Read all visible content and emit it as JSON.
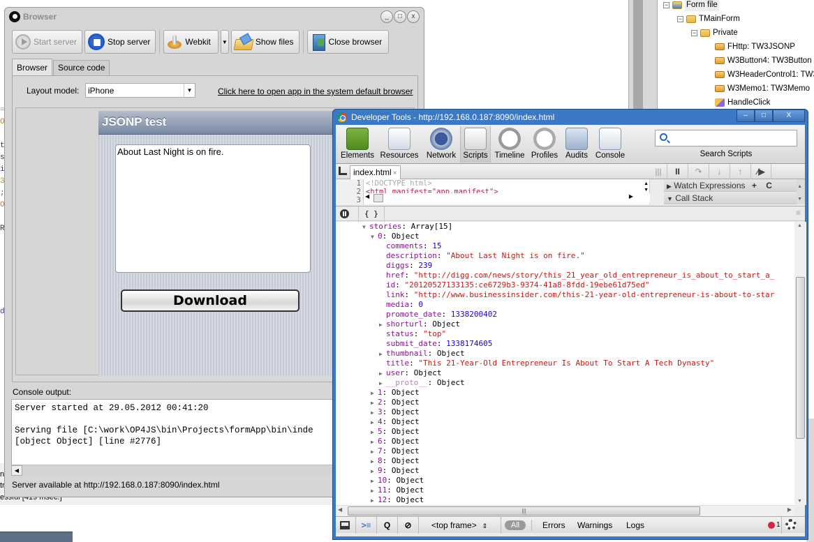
{
  "background": {
    "left_code_glyphs": [
      "=",
      "O",
      "",
      "t",
      "s",
      "i",
      "3",
      ";",
      "O",
      "",
      "R",
      "",
      "",
      "",
      "",
      "",
      "",
      "d"
    ],
    "left_status_lines": [
      "n",
      "tri",
      "essful [419 msec.]"
    ],
    "tree": {
      "items": [
        {
          "label": "Form file",
          "icon": "form-file-icon"
        },
        {
          "label": "TMainForm",
          "icon": "folder-icon"
        },
        {
          "label": "Private",
          "icon": "folder-icon"
        },
        {
          "label": "FHttp: TW3JSONP",
          "icon": "field-icon"
        },
        {
          "label": "W3Button4: TW3Button",
          "icon": "field-icon"
        },
        {
          "label": "W3HeaderControl1: TW3",
          "icon": "field-icon"
        },
        {
          "label": "W3Memo1: TW3Memo",
          "icon": "field-icon"
        },
        {
          "label": "HandleClick",
          "icon": "method-icon"
        }
      ]
    }
  },
  "browser": {
    "title": "Browser",
    "window_controls": [
      "_",
      "□",
      "x"
    ],
    "toolbar": {
      "start_server": "Start server",
      "stop_server": "Stop server",
      "webkit": "Webkit",
      "show_files": "Show files",
      "close_browser": "Close browser"
    },
    "tabs": [
      {
        "label": "Browser",
        "active": true
      },
      {
        "label": "Source code",
        "active": false
      }
    ],
    "layout_label": "Layout model:",
    "layout_value": "iPhone",
    "open_link": "Click here to open app in the system default browser",
    "app": {
      "header": "JSONP test",
      "memo_text": "About Last Night is on fire.",
      "download_button": "Download"
    },
    "console_label": "Console output:",
    "console_lines": [
      "Server started at 29.05.2012 00:41:20",
      "",
      "Serving file [C:\\work\\OP4JS\\bin\\Projects\\formApp\\bin\\inde",
      "[object Object] [line #2776]"
    ],
    "status": "Server available at http://192.168.0.187:8090/index.html"
  },
  "devtools": {
    "title": "Developer Tools - http://192.168.0.187:8090/index.html",
    "window_controls": [
      "–",
      "□",
      "X"
    ],
    "panels": [
      {
        "label": "Elements",
        "icon": "elements-icon"
      },
      {
        "label": "Resources",
        "icon": "resources-icon"
      },
      {
        "label": "Network",
        "icon": "network-icon"
      },
      {
        "label": "Scripts",
        "icon": "scripts-icon",
        "active": true
      },
      {
        "label": "Timeline",
        "icon": "timeline-icon"
      },
      {
        "label": "Profiles",
        "icon": "profiles-icon"
      },
      {
        "label": "Audits",
        "icon": "audits-icon"
      },
      {
        "label": "Console",
        "icon": "console-icon"
      }
    ],
    "search_label": "Search Scripts",
    "search_value": "",
    "file_tab": "index.html",
    "file_tab_close": "×",
    "debugger_buttons": [
      "pause",
      "step-over",
      "step-into",
      "step-out",
      "deactivate-breakpoints"
    ],
    "code_lines": [
      {
        "num": "1",
        "text": "<!DOCTYPE html>"
      },
      {
        "num": "2",
        "text": "<html manifest=\"app.manifest\">"
      },
      {
        "num": "3",
        "text": ""
      }
    ],
    "watch_expressions": "Watch Expressions",
    "call_stack": "Call Stack",
    "pretty_print": "{ }",
    "console_tree": {
      "root": {
        "key": "stories",
        "value": "Array[15]"
      },
      "item0": {
        "key": "0",
        "value": "Object"
      },
      "props": [
        {
          "key": "comments",
          "value": "15",
          "type": "number"
        },
        {
          "key": "description",
          "value": "\"About Last Night is on fire.\"",
          "type": "string"
        },
        {
          "key": "diggs",
          "value": "239",
          "type": "number"
        },
        {
          "key": "href",
          "value": "\"http://digg.com/news/story/this_21_year_old_entrepreneur_is_about_to_start_a_",
          "type": "string"
        },
        {
          "key": "id",
          "value": "\"20120527133135:ce6729b3-9374-41a8-8fdd-19ebe61d75ed\"",
          "type": "string"
        },
        {
          "key": "link",
          "value": "\"http://www.businessinsider.com/this-21-year-old-entrepreneur-is-about-to-star",
          "type": "string"
        },
        {
          "key": "media",
          "value": "0",
          "type": "number"
        },
        {
          "key": "promote_date",
          "value": "1338200402",
          "type": "number"
        },
        {
          "key": "shorturl",
          "value": "Object",
          "type": "object"
        },
        {
          "key": "status",
          "value": "\"top\"",
          "type": "string"
        },
        {
          "key": "submit_date",
          "value": "1338174605",
          "type": "number"
        },
        {
          "key": "thumbnail",
          "value": "Object",
          "type": "object"
        },
        {
          "key": "title",
          "value": "\"This 21-Year-Old Entrepreneur Is About To Start A Tech Dynasty\"",
          "type": "string"
        },
        {
          "key": "user",
          "value": "Object",
          "type": "object"
        },
        {
          "key": "__proto__",
          "value": "Object",
          "type": "proto"
        }
      ],
      "collapsed_items": [
        "1",
        "2",
        "3",
        "4",
        "5",
        "6",
        "7",
        "8",
        "9",
        "10",
        "11",
        "12"
      ],
      "collapsed_value": "Object"
    },
    "bottom_bar": {
      "frame_select": "<top frame>",
      "filters": [
        "All",
        "Errors",
        "Warnings",
        "Logs"
      ],
      "error_count": "1"
    }
  }
}
